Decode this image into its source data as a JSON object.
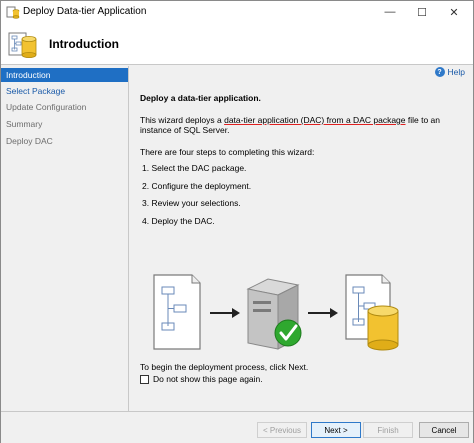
{
  "window": {
    "title": "Deploy Data-tier Application",
    "min_glyph": "—",
    "max_glyph": "☐",
    "close_glyph": "✕"
  },
  "header": {
    "title": "Introduction"
  },
  "nav": {
    "items": [
      {
        "label": "Introduction",
        "state": "active"
      },
      {
        "label": "Select Package",
        "state": "link"
      },
      {
        "label": "Update Configuration",
        "state": "disabled"
      },
      {
        "label": "Summary",
        "state": "disabled"
      },
      {
        "label": "Deploy DAC",
        "state": "disabled"
      }
    ]
  },
  "content": {
    "help_label": "Help",
    "section_title": "Deploy a data-tier application.",
    "p1_a": "This wizard deploys a ",
    "p1_underlined": "data-tier application (DAC) from a DAC package",
    "p1_b": " file to an instance of SQL Server.",
    "p2": "There are four steps to completing this wizard:",
    "steps": [
      "1. Select the DAC package.",
      "2. Configure the deployment.",
      "3. Review your selections.",
      "4. Deploy the DAC."
    ],
    "begin_text": "To begin the deployment process, click Next.",
    "checkbox_label": "Do not show this page again.",
    "checkbox_checked": false
  },
  "footer": {
    "previous": "< Previous",
    "next": "Next >",
    "finish": "Finish",
    "cancel": "Cancel"
  },
  "colors": {
    "accent": "#1f6fc4",
    "underline": "#e02020",
    "check_green": "#2fa82f",
    "db_yellow": "#f2c230"
  }
}
